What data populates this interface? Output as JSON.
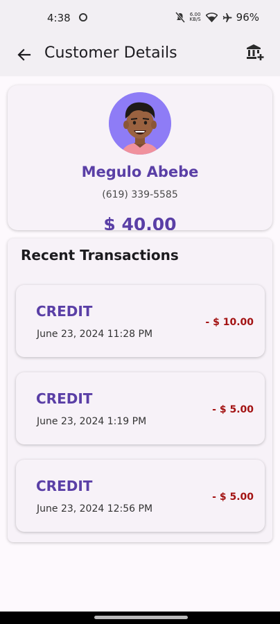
{
  "status_bar": {
    "time": "4:38",
    "speed_top": "6.00",
    "speed_bottom": "KB/S",
    "battery": "96%"
  },
  "app_bar": {
    "title": "Customer Details",
    "back_icon": "arrow-back-icon",
    "action_icon": "bank-add-icon"
  },
  "customer": {
    "name": "Megulo Abebe",
    "phone": "(619) 339-5585",
    "balance": "$ 40.00"
  },
  "transactions": {
    "heading": "Recent Transactions",
    "items": [
      {
        "type": "CREDIT",
        "date": "June 23, 2024 11:28 PM",
        "amount": "- $ 10.00"
      },
      {
        "type": "CREDIT",
        "date": "June 23, 2024 1:19 PM",
        "amount": "- $ 5.00"
      },
      {
        "type": "CREDIT",
        "date": "June 23, 2024 12:56 PM",
        "amount": "- $ 5.00"
      }
    ]
  },
  "colors": {
    "accent": "#5a3fa6",
    "negative": "#a31313",
    "avatar_bg": "#8e7cf6"
  }
}
